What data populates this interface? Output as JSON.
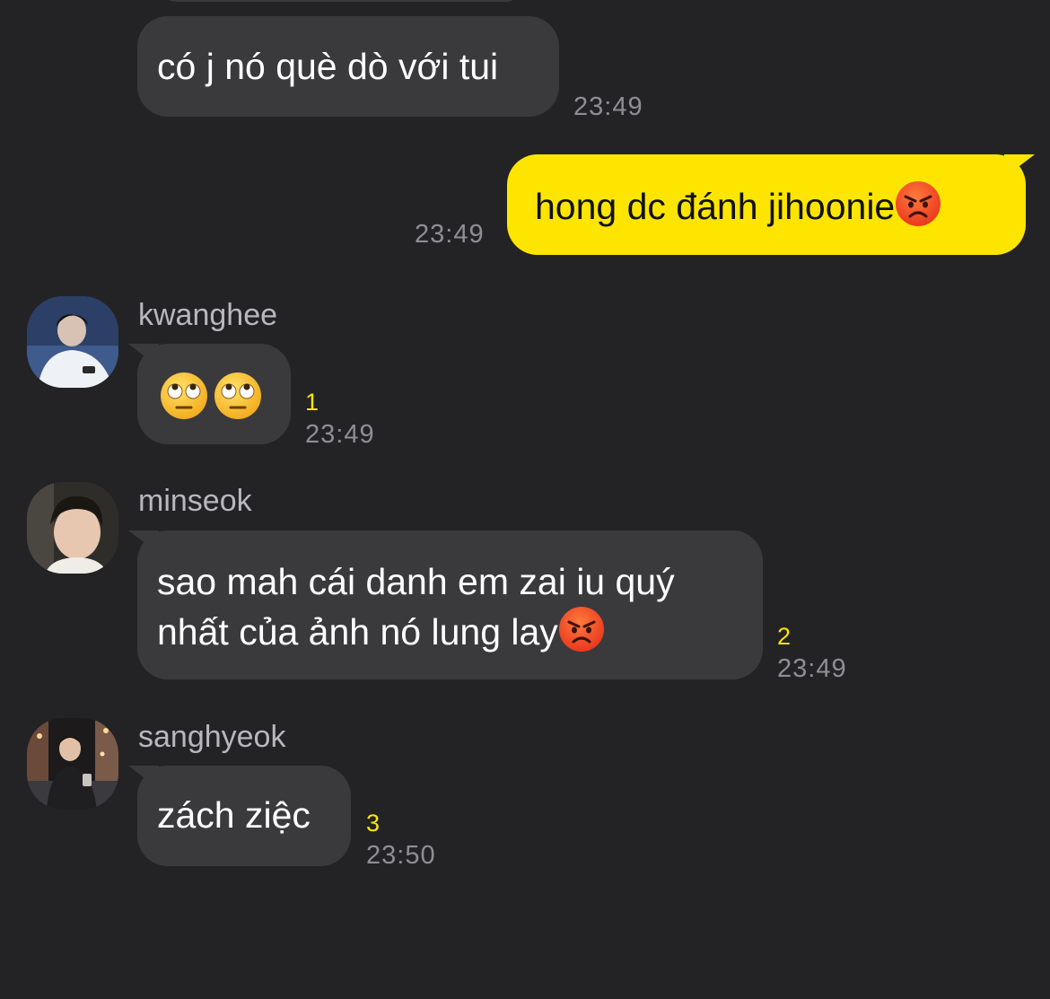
{
  "messages": [
    {
      "text": "có j nó què dò với tui",
      "time": "23:49"
    },
    {
      "text": "hong dc đánh jihoonie",
      "time": "23:49",
      "emoji": "angry-face-emoji"
    },
    {
      "sender": "kwanghee",
      "emojis": [
        "face-with-rolling-eyes-emoji",
        "face-with-rolling-eyes-emoji"
      ],
      "unread": "1",
      "time": "23:49"
    },
    {
      "sender": "minseok",
      "line1": "sao mah cái danh em zai iu quý",
      "line2": "nhất của ảnh nó lung lay",
      "emoji": "angry-face-emoji",
      "unread": "2",
      "time": "23:49"
    },
    {
      "sender": "sanghyeok",
      "text": "zách ziệc",
      "unread": "3",
      "time": "23:50"
    }
  ],
  "colors": {
    "background": "#232326",
    "incoming_bubble": "#3a3a3d",
    "outgoing_bubble": "#fee500",
    "unread_count": "#fee500",
    "timestamp": "#8f8f93"
  }
}
